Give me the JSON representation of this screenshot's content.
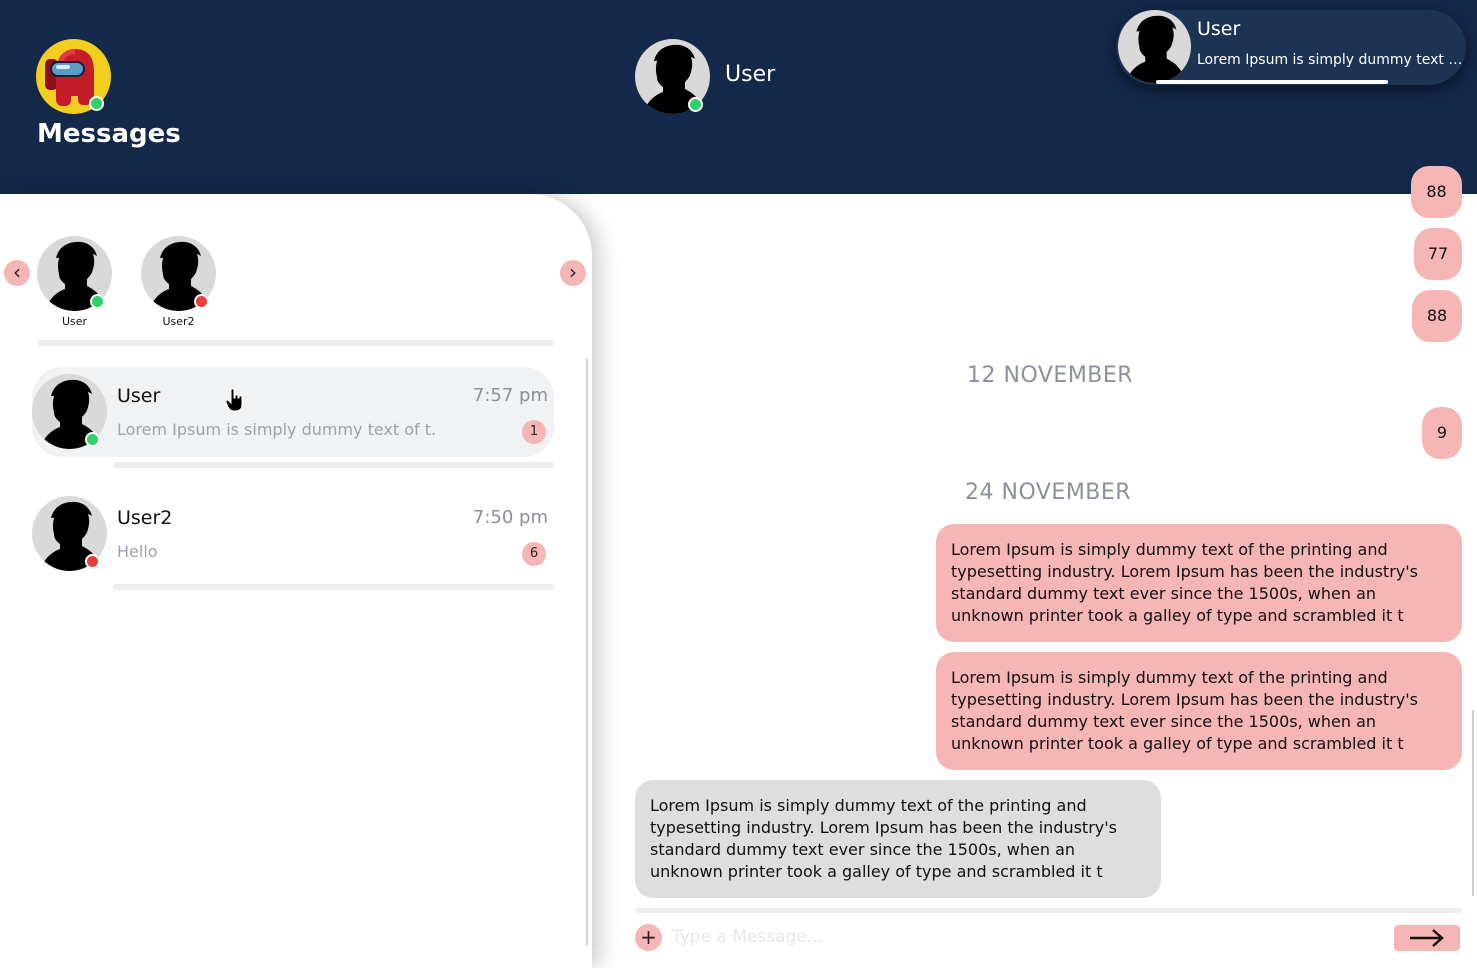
{
  "header": {
    "title": "Messages",
    "active_chat_name": "User"
  },
  "toast": {
    "name": "User",
    "text": "Lorem Ipsum is simply dummy text o..."
  },
  "stories": [
    {
      "label": "User",
      "status": "online"
    },
    {
      "label": "User2",
      "status": "offline"
    }
  ],
  "conversations": [
    {
      "name": "User",
      "time": "7:57 pm",
      "preview": "Lorem Ipsum is simply dummy text of t...",
      "unread": "1",
      "status": "online"
    },
    {
      "name": "User2",
      "time": "7:50 pm",
      "preview": "Hello",
      "unread": "6",
      "status": "offline"
    }
  ],
  "chat": {
    "small_messages": [
      "88",
      "77",
      "88",
      "9"
    ],
    "dates": [
      "12 NOVEMBER",
      "24 NOVEMBER"
    ],
    "long_messages": [
      {
        "direction": "out",
        "text": "Lorem Ipsum is simply dummy text of the printing and typesetting industry. Lorem Ipsum has been the industry's standard dummy text ever since the 1500s, when an unknown printer took a galley of type and scrambled it t"
      },
      {
        "direction": "out",
        "text": "Lorem Ipsum is simply dummy text of the printing and typesetting industry. Lorem Ipsum has been the industry's standard dummy text ever since the 1500s, when an unknown printer took a galley of type and scrambled it t"
      },
      {
        "direction": "in",
        "text": "Lorem Ipsum is simply dummy text of the printing and typesetting industry. Lorem Ipsum has been the industry's standard dummy text ever since the 1500s, when an unknown printer took a galley of type and scrambled it t"
      }
    ]
  },
  "composer": {
    "placeholder": "Type a Message...",
    "attach_label": "+"
  },
  "colors": {
    "header_bg": "#142849",
    "accent_pink": "#f7b6b6",
    "online": "#2fd26a",
    "offline": "#ea3d3d"
  },
  "icons": {
    "self_avatar": "among-us-crewmate-icon",
    "contact_avatar": "person-silhouette-icon",
    "prev": "chevron-left-icon",
    "next": "chevron-right-icon",
    "attach": "plus-icon",
    "send": "arrow-right-icon"
  }
}
